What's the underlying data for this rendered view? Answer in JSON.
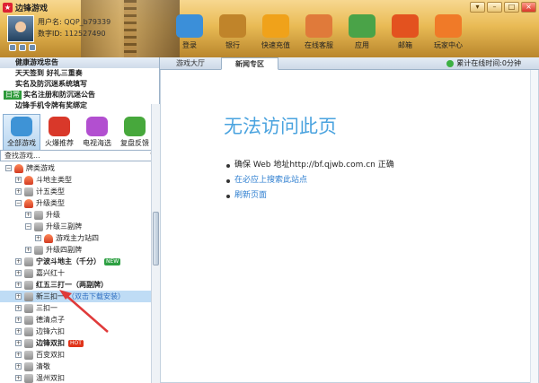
{
  "app": {
    "title": "边锋游戏",
    "icon": "app-logo-icon",
    "window_controls": [
      "menu-icon",
      "minimize-icon",
      "restore-icon",
      "close-icon"
    ]
  },
  "user": {
    "name_label": "用户名",
    "name_value": "QQP_b79339",
    "id_label": "数字ID",
    "id_value": "112527490"
  },
  "nav": [
    {
      "label": "登录",
      "icon": "monitor-icon",
      "color": "#3b8fd9"
    },
    {
      "label": "银行",
      "icon": "wallet-icon",
      "color": "#c0842a"
    },
    {
      "label": "快速充值",
      "icon": "yen-coin-icon",
      "color": "#f0a21a"
    },
    {
      "label": "在线客服",
      "icon": "support-agent-icon",
      "color": "#e07a3a"
    },
    {
      "label": "应用",
      "icon": "apps-icon",
      "color": "#4aa348"
    },
    {
      "label": "邮箱",
      "icon": "mailbox-icon",
      "color": "#e3521f"
    },
    {
      "label": "玩家中心",
      "icon": "party-horn-icon",
      "color": "#f07a28"
    }
  ],
  "notices": [
    {
      "text": "健康游戏忠告"
    },
    {
      "text": "天天签到 好礼三重奏"
    },
    {
      "text": "实名及防沉迷系统填写"
    },
    {
      "tag": "日常",
      "text": "实名注册和防沉迷公告"
    },
    {
      "text": "边锋手机令牌有奖绑定"
    }
  ],
  "game_tabs": [
    {
      "label": "全部游戏",
      "icon": "all-games-icon",
      "color": "#3e93d6"
    },
    {
      "label": "火爆推荐",
      "icon": "gift-icon",
      "color": "#d9382a"
    },
    {
      "label": "电视海选",
      "icon": "tv-icon",
      "color": "#b24fd0"
    },
    {
      "label": "复盘反馈",
      "icon": "chat-bubble-icon",
      "color": "#47a83c"
    }
  ],
  "search": {
    "placeholder": "查找游戏..."
  },
  "tree": [
    {
      "text": "牌类游戏",
      "level": 0,
      "expander": "−",
      "icon": "house",
      "bold": false
    },
    {
      "text": "斗地主类型",
      "level": 1,
      "expander": "+",
      "icon": "house"
    },
    {
      "text": "升级类型",
      "level": 1,
      "expander": "−",
      "icon": "house"
    },
    {
      "text": "升级",
      "level": 2,
      "expander": "+",
      "icon": "game"
    },
    {
      "text": "升级三副牌",
      "level": 2,
      "expander": "−",
      "icon": "game"
    },
    {
      "text": "游戏主力站四",
      "level": 3,
      "expander": "+",
      "icon": "house"
    },
    {
      "text": "升级四副牌",
      "level": 2,
      "expander": "+",
      "icon": "game"
    },
    {
      "text": "宁波斗地主（千分）",
      "level": 1,
      "expander": "+",
      "icon": "game",
      "bold": true,
      "badge": "NEW"
    },
    {
      "text": "嘉兴红十",
      "level": 1,
      "expander": "+",
      "icon": "game"
    },
    {
      "text": "红五三打一（两副牌）",
      "level": 1,
      "expander": "+",
      "icon": "game",
      "bold": true
    },
    {
      "text": "新三扣一",
      "level": 1,
      "expander": "+",
      "icon": "game",
      "hint": "（双击下载安装）",
      "selected": true
    },
    {
      "text": "三扣一",
      "level": 1,
      "expander": "+",
      "icon": "game"
    },
    {
      "text": "德清点子",
      "level": 1,
      "expander": "+",
      "icon": "game"
    },
    {
      "text": "边锋六扣",
      "level": 1,
      "expander": "+",
      "icon": "game"
    },
    {
      "text": "边锋双扣",
      "level": 1,
      "expander": "+",
      "icon": "game",
      "bold": true,
      "badge": "HOT"
    },
    {
      "text": "百变双扣",
      "level": 1,
      "expander": "+",
      "icon": "game"
    },
    {
      "text": "清敬",
      "level": 1,
      "expander": "+",
      "icon": "game"
    },
    {
      "text": "温州双扣",
      "level": 1,
      "expander": "+",
      "icon": "game"
    }
  ],
  "tree_extra": {
    "text": "计五类型",
    "level": 1
  },
  "content_tabs": [
    "游戏大厅",
    "新闻专区"
  ],
  "online_text": "累计在线时间:0分钟",
  "error": {
    "title": "无法访问此页",
    "items": [
      {
        "text": "确保 Web 地址http://bf.qjwb.com.cn 正确",
        "link": false
      },
      {
        "text": "在必应上搜索此站点",
        "link": true
      },
      {
        "text": "刷新页面",
        "link": true
      }
    ]
  },
  "annotation_color": "#e03a3a"
}
